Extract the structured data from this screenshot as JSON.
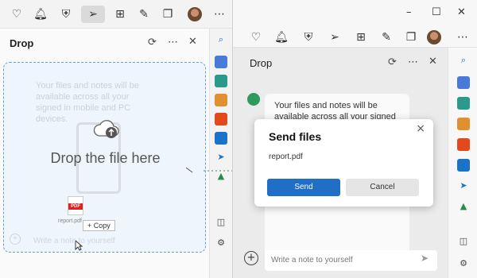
{
  "left": {
    "panel_title": "Drop",
    "ghost_text": "Your files and notes will be available across all your signed in mobile and PC devices.",
    "drop_label": "Drop the file here",
    "drag_file_name": "report.pdf",
    "pdf_badge": "PDF",
    "copy_tip": "+ Copy",
    "footer_placeholder": "Write a note to yourself",
    "icons": {
      "heart": "heartbeat-icon",
      "bell": "bell-icon",
      "shield": "shield-icon",
      "send": "send-icon",
      "grid": "grid-icon",
      "edit": "edit-icon",
      "copy": "copy-icon"
    }
  },
  "right": {
    "panel_title": "Drop",
    "bubble_text": "Your files and notes will be available across all your signed in",
    "dialog": {
      "title": "Send files",
      "file_name": "report.pdf",
      "send_label": "Send",
      "cancel_label": "Cancel"
    },
    "compose_placeholder": "Write a note to yourself"
  },
  "colors": {
    "accent_blue": "#1f6fc6",
    "drop_border": "#6aa0d0",
    "brand_green": "#2e9a5e"
  }
}
